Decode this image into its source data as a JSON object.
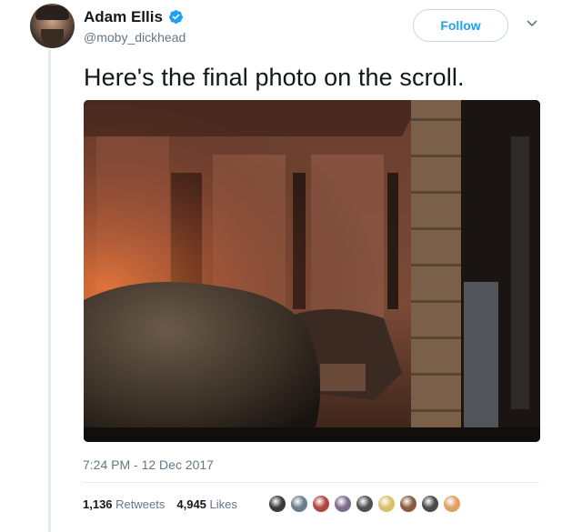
{
  "author": {
    "display_name": "Adam Ellis",
    "handle": "@moby_dickhead",
    "verified": true
  },
  "follow_label": "Follow",
  "tweet": {
    "text": "Here's the final photo on the scroll.",
    "timestamp": "7:24 PM - 12 Dec 2017"
  },
  "stats": {
    "retweets_count": "1,136",
    "retweets_label": "Retweets",
    "likes_count": "4,945",
    "likes_label": "Likes"
  },
  "likers": [
    "#3a3a3a",
    "#6b7d8c",
    "#b0463f",
    "#7d6a8c",
    "#505050",
    "#d8c06a",
    "#8a5a40",
    "#4a4a4a",
    "#e0a060"
  ],
  "colors": {
    "accent": "#1da1f2",
    "secondary_text": "#657786"
  }
}
